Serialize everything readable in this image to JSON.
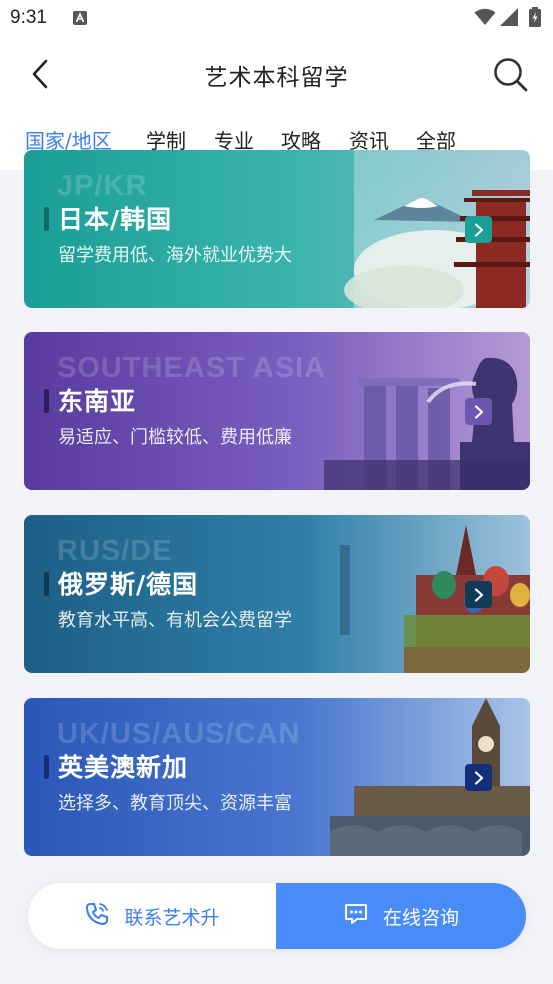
{
  "status_bar": {
    "time": "9:31",
    "notification_icon": "a-notification-icon",
    "icons": [
      "wifi-icon",
      "signal-icon",
      "battery-charging-icon"
    ]
  },
  "header": {
    "title": "艺术本科留学",
    "back_icon": "chevron-left-icon",
    "search_icon": "search-icon"
  },
  "tabs": [
    {
      "label": "国家/地区",
      "active": true
    },
    {
      "label": "学制",
      "active": false
    },
    {
      "label": "专业",
      "active": false
    },
    {
      "label": "攻略",
      "active": false
    },
    {
      "label": "资讯",
      "active": false
    },
    {
      "label": "全部",
      "active": false
    }
  ],
  "destinations": [
    {
      "en": "JP/KR",
      "name": "日本/韩国",
      "desc": "留学费用低、海外就业优势大",
      "accent": "#1a9e96"
    },
    {
      "en": "SOUTHEAST ASIA",
      "name": "东南亚",
      "desc": "易适应、门槛较低、费用低廉",
      "accent": "#5a3b9e"
    },
    {
      "en": "RUS/DE",
      "name": "俄罗斯/德国",
      "desc": "教育水平高、有机会公费留学",
      "accent": "#1d5f86"
    },
    {
      "en": "UK/US/AUS/CAN",
      "name": "英美澳新加",
      "desc": "选择多、教育顶尖、资源丰富",
      "accent": "#2b57b8"
    }
  ],
  "bottom_bar": {
    "contact_label": "联系艺术升",
    "contact_icon": "phone-icon",
    "consult_label": "在线咨询",
    "consult_icon": "chat-icon"
  },
  "colors": {
    "accent": "#3c7ff5",
    "consult_bg": "#4a8cf7"
  }
}
